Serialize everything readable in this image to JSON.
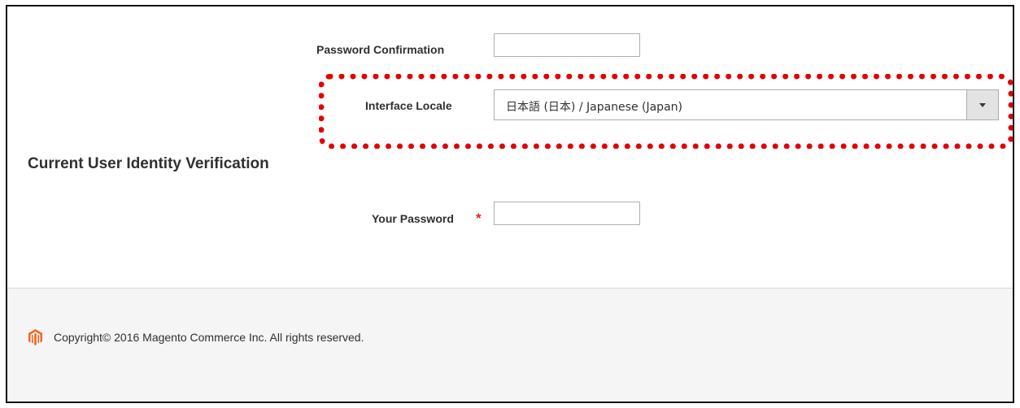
{
  "form": {
    "password_confirmation_label": "Password Confirmation",
    "password_confirmation_value": "",
    "interface_locale_label": "Interface Locale",
    "interface_locale_selected": "日本語 (日本) / Japanese (Japan)",
    "section_title": "Current User Identity Verification",
    "your_password_label": "Your Password",
    "your_password_value": "",
    "required_marker": "*"
  },
  "footer": {
    "logo_icon": "magento-logo-icon",
    "copyright": "Copyright© 2016 Magento Commerce Inc. All rights reserved."
  },
  "colors": {
    "highlight": "#e30000",
    "required": "#e22626",
    "logo": "#f26322",
    "footer_bg": "#f5f5f5"
  }
}
